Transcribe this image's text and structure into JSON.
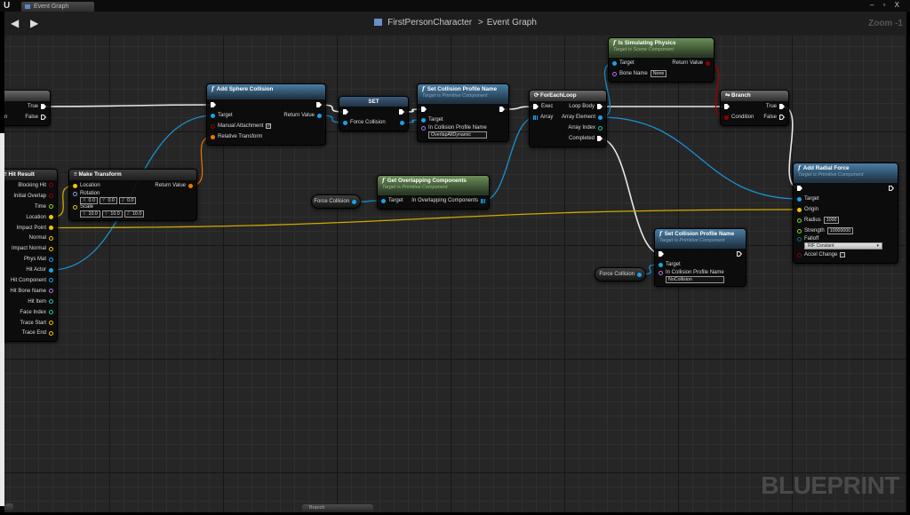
{
  "window": {
    "tab_label": "Event Graph",
    "controls": "– ▫ X"
  },
  "toolbar": {
    "back_icon": "arrow-left",
    "forward_icon": "arrow-right",
    "breadcrumb": [
      "FirstPersonCharacter",
      "Event Graph"
    ],
    "separator": ">",
    "zoom": "Zoom -1"
  },
  "watermark": "BLUEPRINT",
  "bottom_stub": "Branch",
  "pin_colors": {
    "exec": "#ffffff",
    "object": "#1aa3e8",
    "bool": "#8c0000",
    "vector": "#f0c400",
    "transform": "#f07800",
    "rotator": "#8c9ee8",
    "float": "#7cd42c",
    "name": "#b070e0",
    "int": "#22c8a0",
    "byte": "#0a6a6a",
    "array": "#1aa3e8"
  },
  "wire_colors": {
    "exec": "#e8e8e8",
    "object": "#1a90d0",
    "bool": "#a00000",
    "vector": "#d0a800",
    "transform": "#e07000"
  },
  "nodes": [
    {
      "id": "bl",
      "kind": "flow",
      "title": "Branch",
      "rows": [
        {
          "in": {
            "id": "bl_exec",
            "label": "",
            "type": "exec"
          },
          "out": {
            "id": "bl_true",
            "label": "True",
            "type": "exec"
          }
        },
        {
          "in": {
            "id": "bl_cond",
            "label": "Condition",
            "type": "bool"
          },
          "out": {
            "id": "bl_false",
            "label": "False",
            "type": "exec",
            "hollow": true
          }
        }
      ]
    },
    {
      "id": "asc",
      "kind": "fn",
      "title": "Add Sphere Collision",
      "rows": [
        {
          "in": {
            "id": "asc_exec",
            "label": "",
            "type": "exec"
          },
          "out": {
            "id": "asc_then",
            "label": "",
            "type": "exec"
          }
        },
        {
          "in": {
            "id": "asc_target",
            "label": "Target",
            "type": "object"
          },
          "out": {
            "id": "asc_ret",
            "label": "Return Value",
            "type": "object"
          }
        },
        {
          "in": {
            "id": "asc_manual",
            "label": "Manual Attachment",
            "type": "bool",
            "hollow": true,
            "check": "✓"
          }
        },
        {
          "in": {
            "id": "asc_rel",
            "label": "Relative Transform",
            "type": "transform"
          }
        }
      ]
    },
    {
      "id": "set",
      "kind": "set",
      "title": "SET",
      "rows": [
        {
          "in": {
            "id": "set_exec",
            "label": "",
            "type": "exec"
          },
          "out": {
            "id": "set_then",
            "label": "",
            "type": "exec"
          }
        },
        {
          "in": {
            "id": "set_fc",
            "label": "Force Collision",
            "type": "object"
          },
          "out": {
            "id": "set_fc_out",
            "label": "",
            "type": "object"
          }
        }
      ]
    },
    {
      "id": "scp",
      "kind": "fn",
      "title": "Set Collision Profile Name",
      "subtitle": "Target is Primitive Component",
      "rows": [
        {
          "in": {
            "id": "scp_exec",
            "label": "",
            "type": "exec"
          },
          "out": {
            "id": "scp_then",
            "label": "",
            "type": "exec"
          }
        },
        {
          "in": {
            "id": "scp_target",
            "label": "Target",
            "type": "object"
          }
        },
        {
          "in": {
            "id": "scp_name",
            "label": "In Collision Profile Name",
            "type": "name",
            "hollow": true,
            "value": "OverlapAllDynamic"
          }
        }
      ]
    },
    {
      "id": "fe",
      "kind": "flow",
      "title": "ForEachLoop",
      "rows": [
        {
          "in": {
            "id": "fe_exec",
            "label": "Exec",
            "type": "exec"
          },
          "out": {
            "id": "fe_body",
            "label": "Loop Body",
            "type": "exec"
          }
        },
        {
          "in": {
            "id": "fe_array",
            "label": "Array",
            "type": "array"
          },
          "out": {
            "id": "fe_elem",
            "label": "Array Element",
            "type": "object"
          }
        },
        {
          "out": {
            "id": "fe_index",
            "label": "Array Index",
            "type": "int",
            "hollow": true
          }
        },
        {
          "out": {
            "id": "fe_done",
            "label": "Completed",
            "type": "exec"
          }
        }
      ]
    },
    {
      "id": "isp",
      "kind": "pure",
      "title": "Is Simulating Physics",
      "subtitle": "Target is Scene Component",
      "rows": [
        {
          "in": {
            "id": "isp_target",
            "label": "Target",
            "type": "object"
          },
          "out": {
            "id": "isp_ret",
            "label": "Return Value",
            "type": "bool"
          }
        },
        {
          "in": {
            "id": "isp_bone",
            "label": "Bone Name",
            "type": "name",
            "hollow": true,
            "inline": "None"
          }
        }
      ]
    },
    {
      "id": "br",
      "kind": "flow",
      "title": "Branch",
      "rows": [
        {
          "in": {
            "id": "br_exec",
            "label": "",
            "type": "exec"
          },
          "out": {
            "id": "br_true",
            "label": "True",
            "type": "exec"
          }
        },
        {
          "in": {
            "id": "br_cond",
            "label": "Condition",
            "type": "bool"
          },
          "out": {
            "id": "br_false",
            "label": "False",
            "type": "exec",
            "hollow": true
          }
        }
      ]
    },
    {
      "id": "arf",
      "kind": "fn",
      "title": "Add Radial Force",
      "subtitle": "Target is Primitive Component",
      "rows": [
        {
          "in": {
            "id": "arf_exec",
            "label": "",
            "type": "exec"
          },
          "out": {
            "id": "arf_then",
            "label": "",
            "type": "exec",
            "hollow": true
          }
        },
        {
          "in": {
            "id": "arf_target",
            "label": "Target",
            "type": "object"
          }
        },
        {
          "in": {
            "id": "arf_origin",
            "label": "Origin",
            "type": "vector"
          }
        },
        {
          "in": {
            "id": "arf_radius",
            "label": "Radius",
            "type": "float",
            "hollow": true,
            "inline": "1000"
          }
        },
        {
          "in": {
            "id": "arf_strength",
            "label": "Strength",
            "type": "float",
            "hollow": true,
            "inline": "10000000"
          }
        },
        {
          "in": {
            "id": "arf_falloff",
            "label": "Falloff",
            "type": "byte",
            "hollow": true,
            "dropdown": "RIF Constant"
          }
        },
        {
          "in": {
            "id": "arf_accel",
            "label": "Accel Change",
            "type": "bool",
            "hollow": true,
            "check": " "
          }
        }
      ]
    },
    {
      "id": "scp2",
      "kind": "fn",
      "title": "Set Collision Profile Name",
      "subtitle": "Target is Primitive Component",
      "rows": [
        {
          "in": {
            "id": "scp2_exec",
            "label": "",
            "type": "exec"
          },
          "out": {
            "id": "scp2_then",
            "label": "",
            "type": "exec",
            "hollow": true
          }
        },
        {
          "in": {
            "id": "scp2_target",
            "label": "Target",
            "type": "object"
          }
        },
        {
          "in": {
            "id": "scp2_name",
            "label": "In Collision Profile Name",
            "type": "name",
            "hollow": true,
            "value": "NoCollision"
          }
        }
      ]
    },
    {
      "id": "fc1",
      "kind": "getter",
      "rows": [
        {
          "out": {
            "id": "fc1_out",
            "label": "Force Collision",
            "type": "object"
          }
        }
      ]
    },
    {
      "id": "goc",
      "kind": "pure",
      "title": "Get Overlapping Components",
      "subtitle": "Target is Primitive Component",
      "rows": [
        {
          "in": {
            "id": "goc_target",
            "label": "Target",
            "type": "object"
          },
          "out": {
            "id": "goc_out",
            "label": "In Overlapping Components",
            "type": "array"
          }
        }
      ]
    },
    {
      "id": "fc2",
      "kind": "getter",
      "rows": [
        {
          "out": {
            "id": "fc2_out",
            "label": "Force Collision",
            "type": "object"
          }
        }
      ]
    },
    {
      "id": "mt",
      "kind": "plain",
      "title": "Make Transform",
      "rows": [
        {
          "in": {
            "id": "mt_loc",
            "label": "Location",
            "type": "vector"
          },
          "out": {
            "id": "mt_ret",
            "label": "Return Value",
            "type": "transform"
          }
        },
        {
          "in": {
            "id": "mt_rot",
            "label": "Rotation",
            "type": "rotator",
            "hollow": true,
            "vec": [
              "0.0",
              "0.0",
              "0.0"
            ]
          }
        },
        {
          "in": {
            "id": "mt_scale",
            "label": "Scale",
            "type": "vector",
            "hollow": true,
            "vec": [
              "10.0",
              "10.0",
              "10.0"
            ]
          }
        }
      ]
    },
    {
      "id": "hr",
      "kind": "plain",
      "title": "Hit Result",
      "rows": [
        {
          "out": {
            "id": "hr_block",
            "label": "Blocking Hit",
            "type": "bool",
            "hollow": true
          }
        },
        {
          "out": {
            "id": "hr_init",
            "label": "Initial Overlap",
            "type": "bool",
            "hollow": true
          }
        },
        {
          "out": {
            "id": "hr_time",
            "label": "Time",
            "type": "float",
            "hollow": true
          }
        },
        {
          "out": {
            "id": "hr_loc",
            "label": "Location",
            "type": "vector"
          }
        },
        {
          "out": {
            "id": "hr_impact",
            "label": "Impact Point",
            "type": "vector"
          }
        },
        {
          "out": {
            "id": "hr_normal",
            "label": "Normal",
            "type": "vector",
            "hollow": true
          }
        },
        {
          "out": {
            "id": "hr_inormal",
            "label": "Impact Normal",
            "type": "vector",
            "hollow": true
          }
        },
        {
          "out": {
            "id": "hr_phys",
            "label": "Phys Mat",
            "type": "object",
            "hollow": true
          }
        },
        {
          "out": {
            "id": "hr_actor",
            "label": "Hit Actor",
            "type": "object"
          }
        },
        {
          "out": {
            "id": "hr_comp",
            "label": "Hit Component",
            "type": "object",
            "hollow": true
          }
        },
        {
          "out": {
            "id": "hr_bone",
            "label": "Hit Bone Name",
            "type": "name",
            "hollow": true
          }
        },
        {
          "out": {
            "id": "hr_item",
            "label": "Hit Item",
            "type": "int",
            "hollow": true
          }
        },
        {
          "out": {
            "id": "hr_face",
            "label": "Face Index",
            "type": "int",
            "hollow": true
          }
        },
        {
          "out": {
            "id": "hr_tstart",
            "label": "Trace Start",
            "type": "vector",
            "hollow": true
          }
        },
        {
          "out": {
            "id": "hr_tend",
            "label": "Trace End",
            "type": "vector",
            "hollow": true
          }
        }
      ]
    }
  ],
  "connections": [
    [
      "bl_true",
      "asc_exec",
      "exec"
    ],
    [
      "asc_then",
      "set_exec",
      "exec"
    ],
    [
      "set_then",
      "scp_exec",
      "exec"
    ],
    [
      "scp_then",
      "fe_exec",
      "exec"
    ],
    [
      "fe_body",
      "br_exec",
      "exec"
    ],
    [
      "br_true",
      "arf_exec",
      "exec"
    ],
    [
      "fe_done",
      "scp2_exec",
      "exec"
    ],
    [
      "asc_ret",
      "set_fc",
      "object"
    ],
    [
      "set_fc_out",
      "scp_target",
      "object"
    ],
    [
      "hr_actor",
      "asc_target",
      "object"
    ],
    [
      "fc1_out",
      "goc_target",
      "object"
    ],
    [
      "goc_out",
      "fe_array",
      "object"
    ],
    [
      "fe_elem",
      "isp_target",
      "object"
    ],
    [
      "fe_elem",
      "arf_target",
      "object"
    ],
    [
      "fc2_out",
      "scp2_target",
      "object"
    ],
    [
      "mt_ret",
      "asc_rel",
      "transform"
    ],
    [
      "hr_loc",
      "mt_loc",
      "vector"
    ],
    [
      "hr_impact",
      "arf_origin",
      "vector"
    ],
    [
      "isp_ret",
      "br_cond",
      "bool"
    ]
  ]
}
